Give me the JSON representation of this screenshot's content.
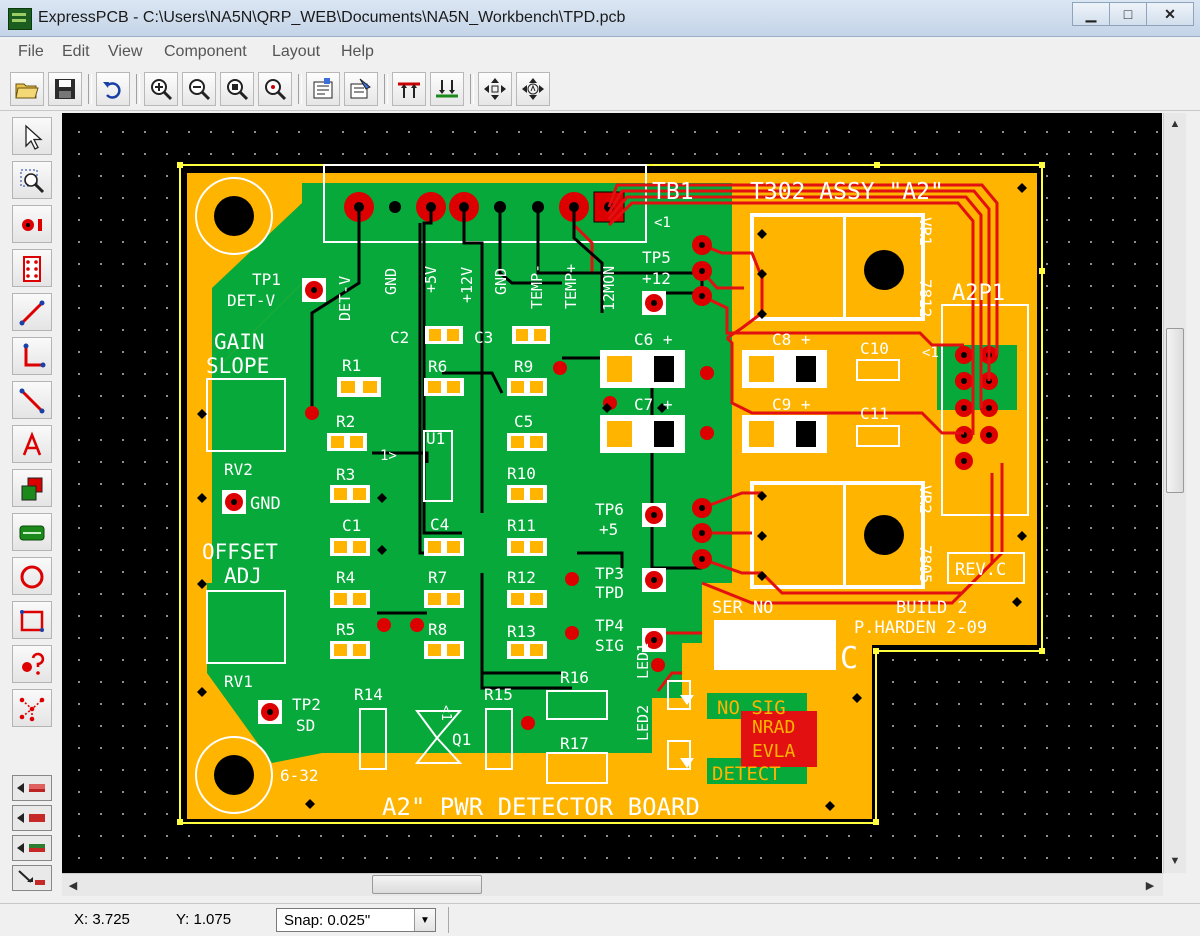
{
  "window": {
    "title": "ExpressPCB - C:\\Users\\NA5N\\QRP_WEB\\Documents\\NA5N_Workbench\\TPD.pcb",
    "minimize_glyph": "▁",
    "maximize_glyph": "□",
    "close_glyph": "✕"
  },
  "menu": [
    "File",
    "Edit",
    "View",
    "Component",
    "Layout",
    "Help"
  ],
  "toolbar": {
    "icons": [
      "open-folder-icon",
      "save-icon",
      "undo-icon",
      "zoom-in-icon",
      "zoom-out-icon",
      "zoom-window-icon",
      "zoom-fit-icon",
      "properties-icon",
      "component-manager-icon",
      "top-layer-icon",
      "bottom-layer-icon",
      "rotate-icon",
      "autorotate-icon"
    ]
  },
  "tools": [
    "select-arrow-icon",
    "zoom-select-icon",
    "pad-tool-icon",
    "component-tool-icon",
    "trace-tool-icon",
    "corner-trace-icon",
    "diagonal-trace-icon",
    "text-tool-icon",
    "layer-swap-icon",
    "component-place-icon",
    "ring-tool-icon",
    "rectangle-tool-icon",
    "query-tool-icon",
    "net-tool-icon"
  ],
  "layer_buttons": [
    "layer-top-icon",
    "layer-bottom-icon",
    "layer-ground-icon",
    "layer-route-icon"
  ],
  "status": {
    "x": "X: 3.725",
    "y": "Y: 1.075",
    "snap": "Snap:  0.025\""
  },
  "pcb": {
    "title_label": "T302  ASSY  \"A2\"",
    "tb1_label": "TB1",
    "tb1_pin1": "<1",
    "a2p1_label": "A2P1",
    "a2p1_pin": "<1",
    "rev_label": "REV.C",
    "build_label": "BUILD 2",
    "author_label": "P.HARDEN 2-09",
    "ser_label": "SER NO",
    "corner_c": "C",
    "board_name": "A2\" PWR DETECTOR BOARD",
    "mount_label": "6-32",
    "gain_slope": [
      "GAIN",
      "SLOPE"
    ],
    "offset_adj": [
      "OFFSET",
      "ADJ"
    ],
    "no_sig": "NO SIG",
    "detect": "DETECT",
    "mirrored_text": [
      "NRAD",
      "EVLA"
    ],
    "pin_labels": [
      "DET-V",
      "GND",
      "+5V",
      "+12V",
      "GND",
      "TEMP-",
      "TEMP+",
      "12MON"
    ],
    "testpoints": {
      "tp1": [
        "TP1",
        "DET-V"
      ],
      "tp2": [
        "TP2",
        "SD"
      ],
      "tp3": [
        "TP3",
        "TPD"
      ],
      "tp4": [
        "TP4",
        "SIG"
      ],
      "tp5": [
        "TP5",
        "+12"
      ],
      "tp6": [
        "TP6",
        "+5"
      ],
      "gnd": "GND"
    },
    "components": {
      "c2": "C2",
      "c3": "C3",
      "c4": "C4",
      "c5": "C5",
      "c1": "C1",
      "c6": "C6 +",
      "c7": "C7 +",
      "c8": "C8 +",
      "c9": "C9 +",
      "c10": "C10",
      "c11": "C11",
      "r1": "R1",
      "r2": "R2",
      "r3": "R3",
      "r4": "R4",
      "r5": "R5",
      "r6": "R6",
      "r7": "R7",
      "r8": "R8",
      "r9": "R9",
      "r10": "R10",
      "r11": "R11",
      "r12": "R12",
      "r13": "R13",
      "r14": "R14",
      "r15": "R15",
      "r16": "R16",
      "r17": "R17",
      "u1": "U1",
      "u1_pin": "1>",
      "q1": "Q1",
      "q1_pin": "<1",
      "rv1": "RV1",
      "rv2": "RV2",
      "led1": "LED1",
      "led2": "LED2",
      "vr1": [
        "VR1",
        "7812"
      ],
      "vr2": [
        "VR2",
        "7805"
      ]
    }
  }
}
